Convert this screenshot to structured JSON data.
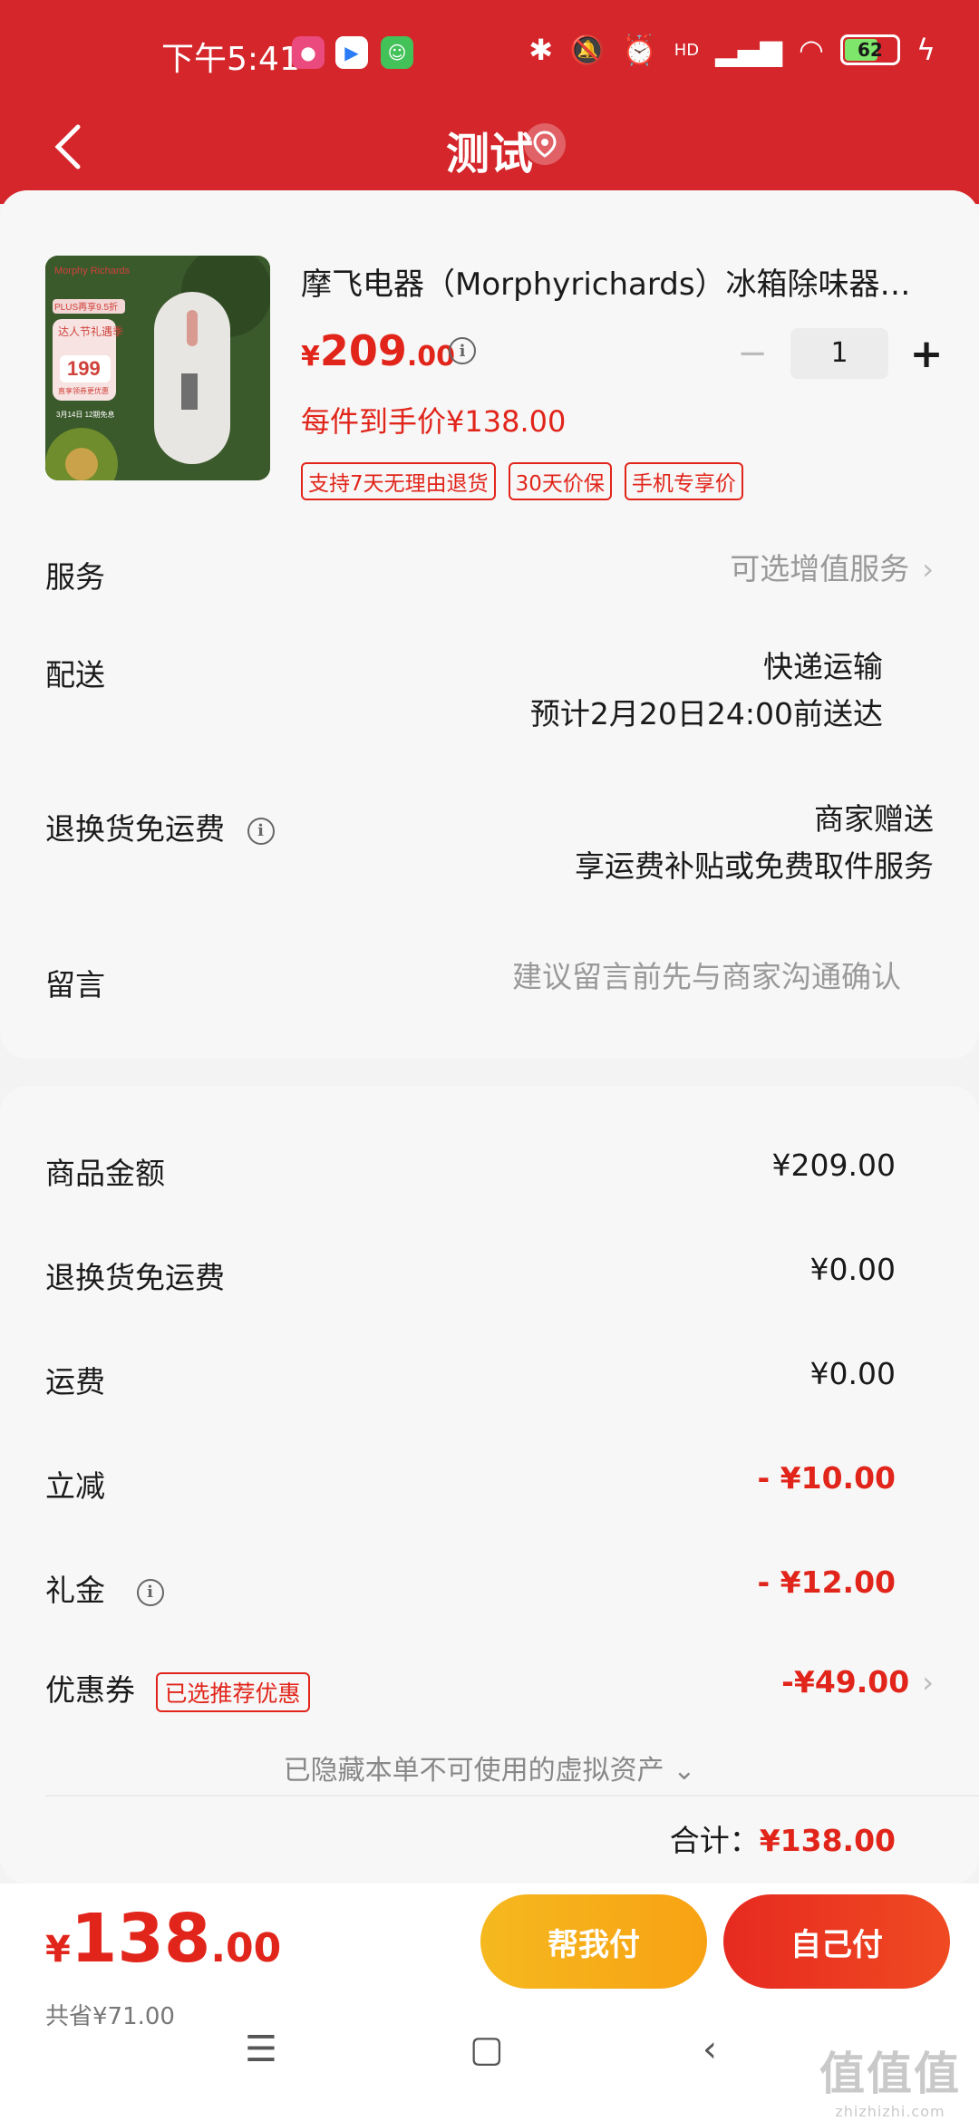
{
  "status_bar": {
    "time": "下午5:41",
    "battery": "62",
    "hd": "HD"
  },
  "header": {
    "title": "测试"
  },
  "product": {
    "title": "摩飞电器（Morphyrichards）冰箱除味器…",
    "price_currency": "¥",
    "price_int": "209",
    "price_dec": ".00",
    "quantity": "1",
    "per_item_price": "每件到手价¥138.00",
    "tags": [
      "支持7天无理由退货",
      "30天价保",
      "手机专享价"
    ],
    "image_texts": {
      "badge1": "PLUS再享9.5折",
      "badge2": "达人节礼遇季",
      "badge3": "199",
      "badge4": "直享领券更优惠",
      "badge5": "3月14日 12期免息"
    },
    "image_brand": "Morphy Richards"
  },
  "rows": {
    "service": {
      "label": "服务",
      "value": "可选增值服务"
    },
    "delivery": {
      "label": "配送",
      "value": "快递运输",
      "value2": "预计2月20日24:00前送达"
    },
    "return_freight": {
      "label": "退换货免运费",
      "value": "商家赠送",
      "value2": "享运费补贴或免费取件服务"
    },
    "message": {
      "label": "留言",
      "placeholder": "建议留言前先与商家沟通确认"
    }
  },
  "summary": {
    "goods_amount": {
      "label": "商品金额",
      "value": "¥209.00"
    },
    "return_fee": {
      "label": "退换货免运费",
      "value": "¥0.00"
    },
    "shipping": {
      "label": "运费",
      "value": "¥0.00"
    },
    "discount": {
      "label": "立减",
      "value": "- ¥10.00"
    },
    "gift_money": {
      "label": "礼金",
      "value": "- ¥12.00"
    },
    "coupon": {
      "label": "优惠券",
      "tag": "已选推荐优惠",
      "value": "-¥49.00"
    },
    "hidden_assets": "已隐藏本单不可使用的虚拟资产 ⌄",
    "total_label": "合计：",
    "total_value": "¥138.00"
  },
  "bottom_bar": {
    "currency": "¥",
    "price_int": "138",
    "price_dec": ".00",
    "saved": "共省¥71.00",
    "help_pay": "帮我付",
    "self_pay": "自己付"
  },
  "watermark": {
    "main": "值值值",
    "sub": "zhizhizhi.com"
  },
  "colors": {
    "brand_red": "#d4262b",
    "price_red": "#e1251b",
    "help_btn": "#f5b81f"
  }
}
